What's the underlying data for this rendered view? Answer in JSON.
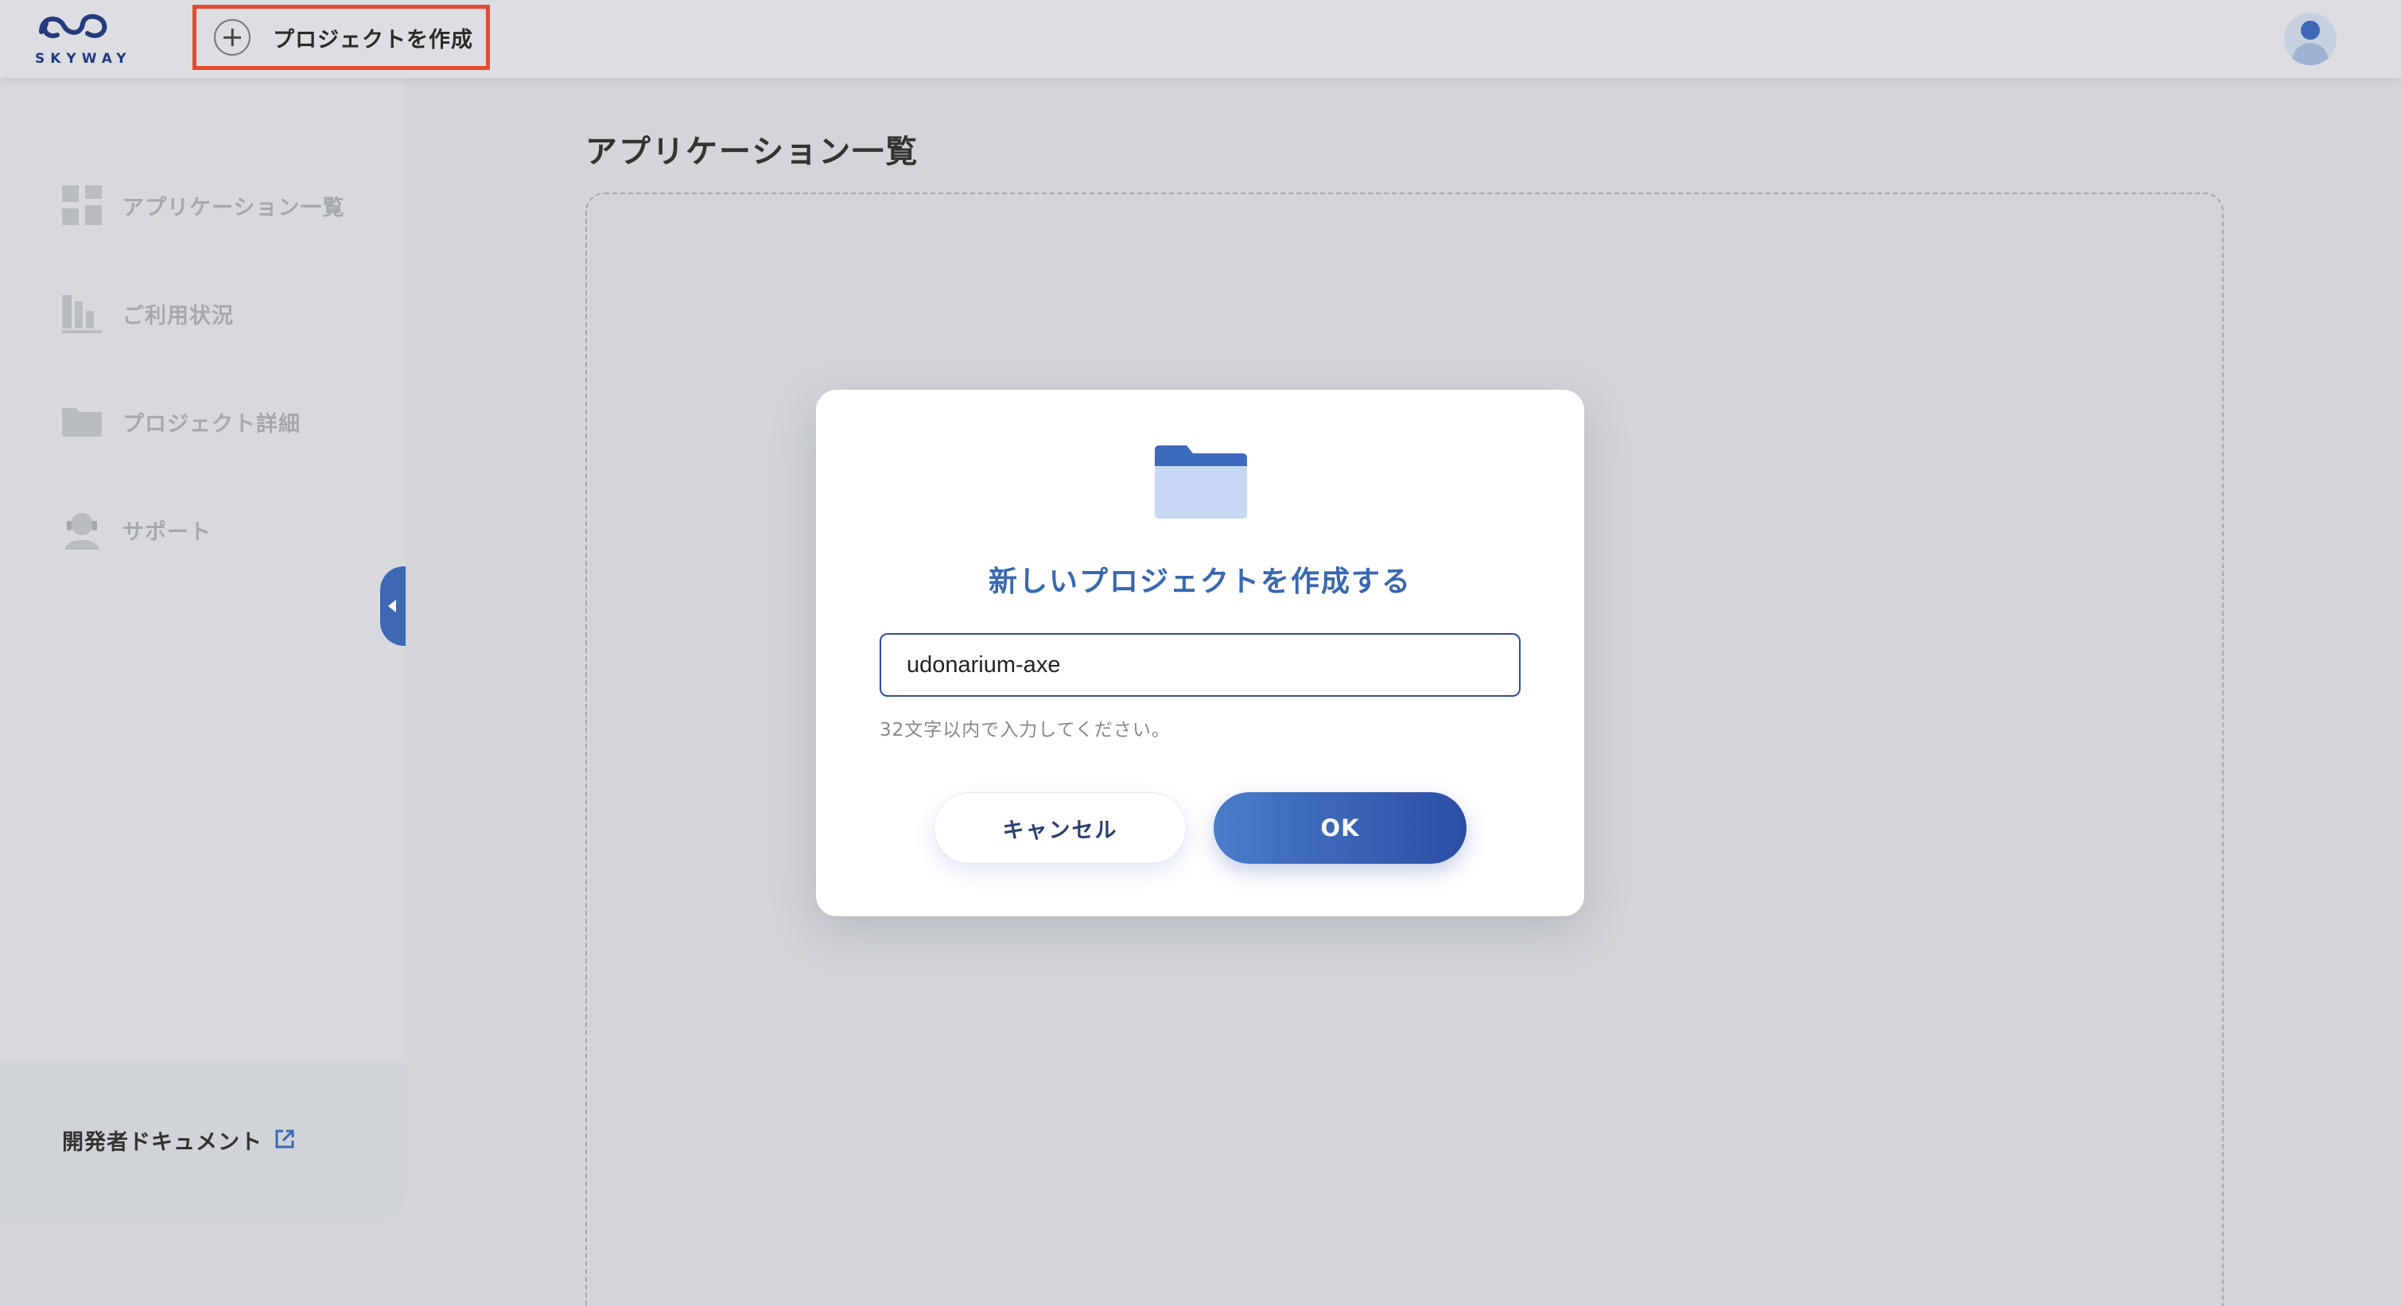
{
  "header": {
    "logo_text": "SKYWAY",
    "create_project_label": "プロジェクトを作成"
  },
  "sidebar": {
    "items": [
      {
        "label": "アプリケーション一覧",
        "icon": "grid-icon"
      },
      {
        "label": "ご利用状況",
        "icon": "bar-chart-icon"
      },
      {
        "label": "プロジェクト詳細",
        "icon": "folder-icon"
      },
      {
        "label": "サポート",
        "icon": "support-icon"
      }
    ],
    "footer_link": "開発者ドキュメント"
  },
  "main": {
    "title": "アプリケーション一覧"
  },
  "modal": {
    "title": "新しいプロジェクトを作成する",
    "input_value": "udonarium-axe",
    "hint": "32文字以内で入力してください。",
    "cancel_label": "キャンセル",
    "ok_label": "OK"
  },
  "colors": {
    "accent": "#3c68b5",
    "highlight_border": "#e64a2e",
    "sidebar_text": "#a5a8ae"
  }
}
